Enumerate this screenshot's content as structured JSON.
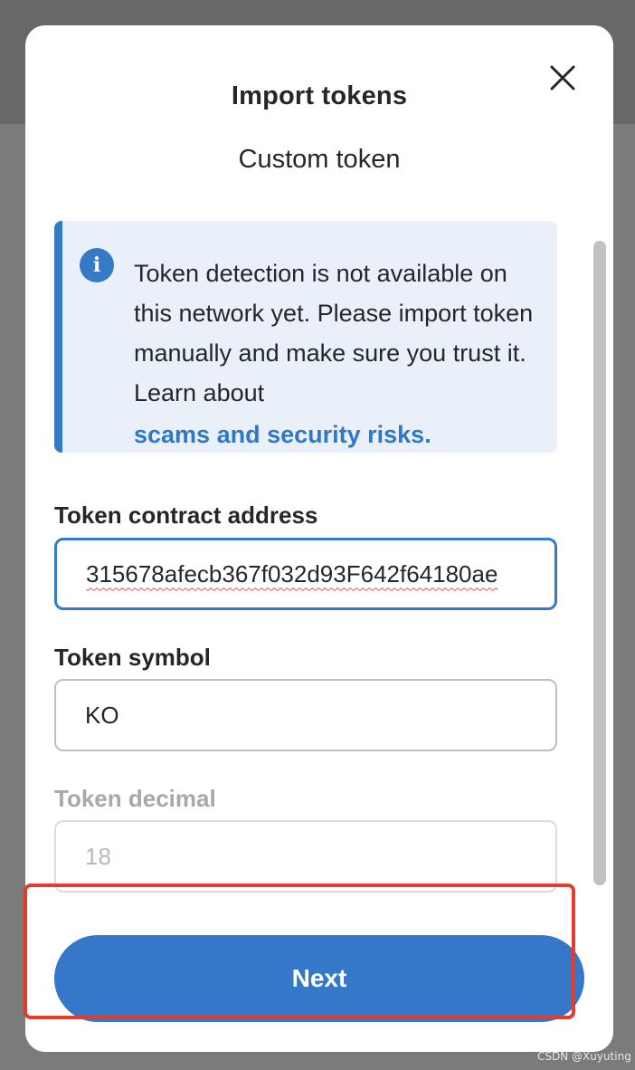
{
  "modal": {
    "title": "Import tokens",
    "subtitle": "Custom token",
    "close_icon": "close-icon"
  },
  "banner": {
    "icon": "info-icon",
    "icon_glyph": "i",
    "text": "Token detection is not available on this network yet. Please import token manually and make sure you trust it. Learn about",
    "link": "scams and security risks."
  },
  "fields": {
    "address": {
      "label": "Token contract address",
      "value": "315678afecb367f032d93F642f64180ae"
    },
    "symbol": {
      "label": "Token symbol",
      "value": "KO"
    },
    "decimal": {
      "label": "Token decimal",
      "value": "18"
    }
  },
  "actions": {
    "next_label": "Next"
  },
  "watermark": "CSDN @Xuyuting",
  "colors": {
    "accent": "#3577c8",
    "highlight": "#e53b2c",
    "banner_bg": "#eaf0f9"
  }
}
